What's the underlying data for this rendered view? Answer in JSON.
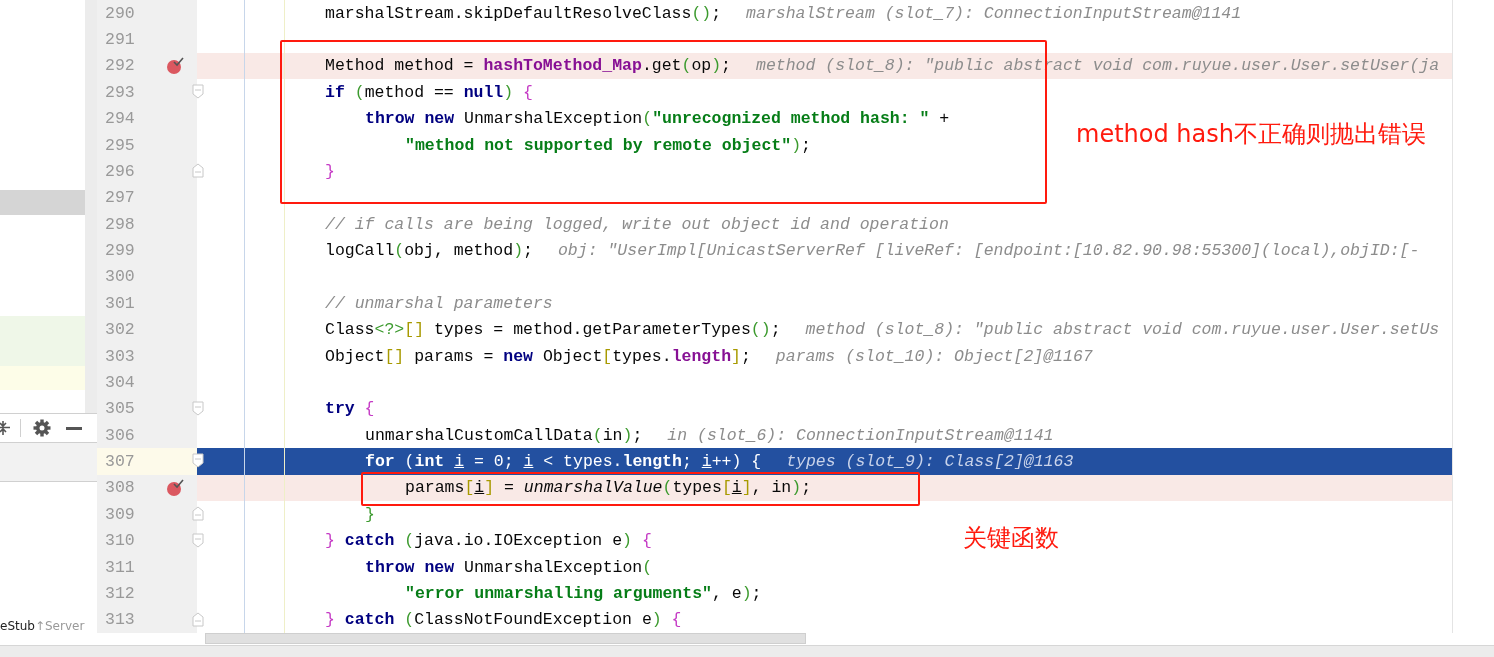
{
  "left_panel": {
    "rows": [
      {
        "kind": "selected"
      },
      {
        "kind": "added"
      },
      {
        "kind": "modified"
      }
    ],
    "footer": {
      "name": "eStub",
      "location": "↑Server"
    }
  },
  "editor": {
    "lines": [
      {
        "number": "290",
        "breakpoint": false,
        "current": false,
        "fold_start": false,
        "fold_end": false,
        "segments": [
          {
            "text": "marshalStream.skipDefaultResolveClass",
            "kind": "plain"
          },
          {
            "text": "()",
            "kind": "paren"
          },
          {
            "text": ";",
            "kind": "plain"
          }
        ],
        "hint": "marshalStream (slot_7): ConnectionInputStream@1141"
      },
      {
        "number": "291",
        "breakpoint": false,
        "current": false,
        "fold_start": false,
        "fold_end": false
      },
      {
        "number": "292",
        "breakpoint": true,
        "current": false,
        "fold_start": false,
        "fold_end": false,
        "segments": [
          {
            "text": "Method method = ",
            "kind": "plain"
          },
          {
            "text": "hashToMethod_Map",
            "kind": "field"
          },
          {
            "text": ".get",
            "kind": "plain"
          },
          {
            "text": "(",
            "kind": "paren"
          },
          {
            "text": "op",
            "kind": "plain"
          },
          {
            "text": ")",
            "kind": "paren"
          },
          {
            "text": ";",
            "kind": "plain"
          }
        ],
        "hint": "method (slot_8): \"public abstract void com.ruyue.user.User.setUser(ja"
      },
      {
        "number": "293",
        "breakpoint": false,
        "current": false,
        "fold_start": true,
        "fold_end": false,
        "segments": [
          {
            "text": "if",
            "kind": "keyword"
          },
          {
            "text": " (",
            "kind": "paren"
          },
          {
            "text": "method == ",
            "kind": "plain"
          },
          {
            "text": "null",
            "kind": "keyword"
          },
          {
            "text": ")",
            "kind": "paren"
          },
          {
            "text": " {",
            "kind": "brace"
          }
        ],
        "children": [
          {
            "number": "294",
            "breakpoint": false,
            "current": false,
            "fold_start": false,
            "fold_end": false,
            "segments": [
              {
                "text": "throw new",
                "kind": "keyword"
              },
              {
                "text": " UnmarshalException",
                "kind": "plain"
              },
              {
                "text": "(",
                "kind": "paren"
              },
              {
                "text": "\"unrecognized method hash: \"",
                "kind": "string"
              },
              {
                "text": " +",
                "kind": "plain"
              }
            ],
            "children": [
              {
                "number": "295",
                "breakpoint": false,
                "current": false,
                "fold_start": false,
                "fold_end": false,
                "segments": [
                  {
                    "text": "\"method not supported by remote object\"",
                    "kind": "string"
                  },
                  {
                    "text": ")",
                    "kind": "paren"
                  },
                  {
                    "text": ";",
                    "kind": "plain"
                  }
                ]
              }
            ]
          }
        ]
      },
      {
        "number": "296",
        "breakpoint": false,
        "current": false,
        "fold_start": false,
        "fold_end": true,
        "segments": [
          {
            "text": "}",
            "kind": "brace"
          }
        ]
      },
      {
        "number": "297",
        "breakpoint": false,
        "current": false,
        "fold_start": false,
        "fold_end": false
      },
      {
        "number": "298",
        "breakpoint": false,
        "current": false,
        "fold_start": false,
        "fold_end": false,
        "segments": [
          {
            "text": "// if calls are being logged, write out object id and operation",
            "kind": "comment"
          }
        ]
      },
      {
        "number": "299",
        "breakpoint": false,
        "current": false,
        "fold_start": false,
        "fold_end": false,
        "segments": [
          {
            "text": "logCall",
            "kind": "plain"
          },
          {
            "text": "(",
            "kind": "paren"
          },
          {
            "text": "obj, method",
            "kind": "plain"
          },
          {
            "text": ")",
            "kind": "paren"
          },
          {
            "text": ";",
            "kind": "plain"
          }
        ],
        "hint": "obj: \"UserImpl[UnicastServerRef [liveRef: [endpoint:[10.82.90.98:55300](local),objID:[-"
      },
      {
        "number": "300",
        "breakpoint": false,
        "current": false,
        "fold_start": false,
        "fold_end": false
      },
      {
        "number": "301",
        "breakpoint": false,
        "current": false,
        "fold_start": false,
        "fold_end": false,
        "segments": [
          {
            "text": "// unmarshal parameters",
            "kind": "comment"
          }
        ]
      },
      {
        "number": "302",
        "breakpoint": false,
        "current": false,
        "fold_start": false,
        "fold_end": false,
        "segments": [
          {
            "text": "Class",
            "kind": "plain"
          },
          {
            "text": "<?>",
            "kind": "generic"
          },
          {
            "text": "[]",
            "kind": "bracket"
          },
          {
            "text": " types = method.getParameterTypes",
            "kind": "plain"
          },
          {
            "text": "()",
            "kind": "paren"
          },
          {
            "text": ";",
            "kind": "plain"
          }
        ],
        "hint": "method (slot_8): \"public abstract void com.ruyue.user.User.setUs"
      },
      {
        "number": "303",
        "breakpoint": false,
        "current": false,
        "fold_start": false,
        "fold_end": false,
        "segments": [
          {
            "text": "Object",
            "kind": "plain"
          },
          {
            "text": "[]",
            "kind": "bracket"
          },
          {
            "text": " params = ",
            "kind": "plain"
          },
          {
            "text": "new",
            "kind": "keyword"
          },
          {
            "text": " Object",
            "kind": "plain"
          },
          {
            "text": "[",
            "kind": "bracket"
          },
          {
            "text": "types.",
            "kind": "plain"
          },
          {
            "text": "length",
            "kind": "field"
          },
          {
            "text": "]",
            "kind": "bracket"
          },
          {
            "text": ";",
            "kind": "plain"
          }
        ],
        "hint": "params (slot_10): Object[2]@1167"
      },
      {
        "number": "304",
        "breakpoint": false,
        "current": false,
        "fold_start": false,
        "fold_end": false
      },
      {
        "number": "305",
        "breakpoint": false,
        "current": false,
        "fold_start": true,
        "fold_end": false,
        "segments": [
          {
            "text": "try",
            "kind": "keyword"
          },
          {
            "text": " {",
            "kind": "brace"
          }
        ],
        "children": [
          {
            "number": "306",
            "breakpoint": false,
            "current": false,
            "fold_start": false,
            "fold_end": false,
            "segments": [
              {
                "text": "unmarshalCustomCallData",
                "kind": "plain"
              },
              {
                "text": "(",
                "kind": "paren"
              },
              {
                "text": "in",
                "kind": "plain"
              },
              {
                "text": ")",
                "kind": "paren"
              },
              {
                "text": ";",
                "kind": "plain"
              }
            ],
            "hint": "in (slot_6): ConnectionInputStream@1141"
          },
          {
            "number": "307",
            "breakpoint": false,
            "current": true,
            "fold_start": true,
            "fold_end": false,
            "segments": [
              {
                "text": "for",
                "kind": "keyword"
              },
              {
                "text": " (",
                "kind": "plain"
              },
              {
                "text": "int ",
                "kind": "keyword"
              },
              {
                "text": "i",
                "kind": "var"
              },
              {
                "text": " = 0; ",
                "kind": "plain"
              },
              {
                "text": "i",
                "kind": "var"
              },
              {
                "text": " < types.",
                "kind": "plain"
              },
              {
                "text": "length",
                "kind": "field"
              },
              {
                "text": "; ",
                "kind": "plain"
              },
              {
                "text": "i",
                "kind": "var"
              },
              {
                "text": "++) {",
                "kind": "plain"
              }
            ],
            "hint": "types (slot_9): Class[2]@1163",
            "children": [
              {
                "number": "308",
                "breakpoint": true,
                "current": false,
                "fold_start": false,
                "fold_end": false,
                "segments": [
                  {
                    "text": "params",
                    "kind": "plain"
                  },
                  {
                    "text": "[",
                    "kind": "bracket"
                  },
                  {
                    "text": "i",
                    "kind": "var"
                  },
                  {
                    "text": "]",
                    "kind": "bracket"
                  },
                  {
                    "text": " = ",
                    "kind": "plain"
                  },
                  {
                    "text": "unmarshalValue",
                    "kind": "static"
                  },
                  {
                    "text": "(",
                    "kind": "paren"
                  },
                  {
                    "text": "types",
                    "kind": "plain"
                  },
                  {
                    "text": "[",
                    "kind": "bracket"
                  },
                  {
                    "text": "i",
                    "kind": "var"
                  },
                  {
                    "text": "]",
                    "kind": "bracket"
                  },
                  {
                    "text": ", in",
                    "kind": "plain"
                  },
                  {
                    "text": ")",
                    "kind": "paren"
                  },
                  {
                    "text": ";",
                    "kind": "plain"
                  }
                ]
              }
            ]
          },
          {
            "number": "309",
            "breakpoint": false,
            "current": false,
            "fold_start": false,
            "fold_end": true,
            "segments": [
              {
                "text": "}",
                "kind": "paren"
              }
            ]
          }
        ]
      },
      {
        "number": "310",
        "breakpoint": false,
        "current": false,
        "fold_start": true,
        "fold_end": false,
        "segments": [
          {
            "text": "}",
            "kind": "brace"
          },
          {
            "text": " catch",
            "kind": "keyword"
          },
          {
            "text": " (",
            "kind": "paren"
          },
          {
            "text": "java.io.IOException e",
            "kind": "plain"
          },
          {
            "text": ")",
            "kind": "paren"
          },
          {
            "text": " {",
            "kind": "brace"
          }
        ],
        "children": [
          {
            "number": "311",
            "breakpoint": false,
            "current": false,
            "fold_start": false,
            "fold_end": false,
            "segments": [
              {
                "text": "throw new",
                "kind": "keyword"
              },
              {
                "text": " UnmarshalException",
                "kind": "plain"
              },
              {
                "text": "(",
                "kind": "paren"
              }
            ],
            "children": [
              {
                "number": "312",
                "breakpoint": false,
                "current": false,
                "fold_start": false,
                "fold_end": false,
                "segments": [
                  {
                    "text": "\"error unmarshalling arguments\"",
                    "kind": "string"
                  },
                  {
                    "text": ", e",
                    "kind": "plain"
                  },
                  {
                    "text": ")",
                    "kind": "paren"
                  },
                  {
                    "text": ";",
                    "kind": "plain"
                  }
                ]
              }
            ]
          }
        ]
      },
      {
        "number": "313",
        "breakpoint": false,
        "current": false,
        "fold_start": false,
        "fold_end": true,
        "segments": [
          {
            "text": "}",
            "kind": "brace"
          },
          {
            "text": " catch",
            "kind": "keyword"
          },
          {
            "text": " (",
            "kind": "paren"
          },
          {
            "text": "ClassNotFoundException e",
            "kind": "plain"
          },
          {
            "text": ")",
            "kind": "paren"
          },
          {
            "text": " {",
            "kind": "brace"
          }
        ]
      }
    ]
  },
  "annotations": [
    {
      "text": "method hash不正确则抛出错误"
    },
    {
      "text": "关键函数"
    }
  ]
}
